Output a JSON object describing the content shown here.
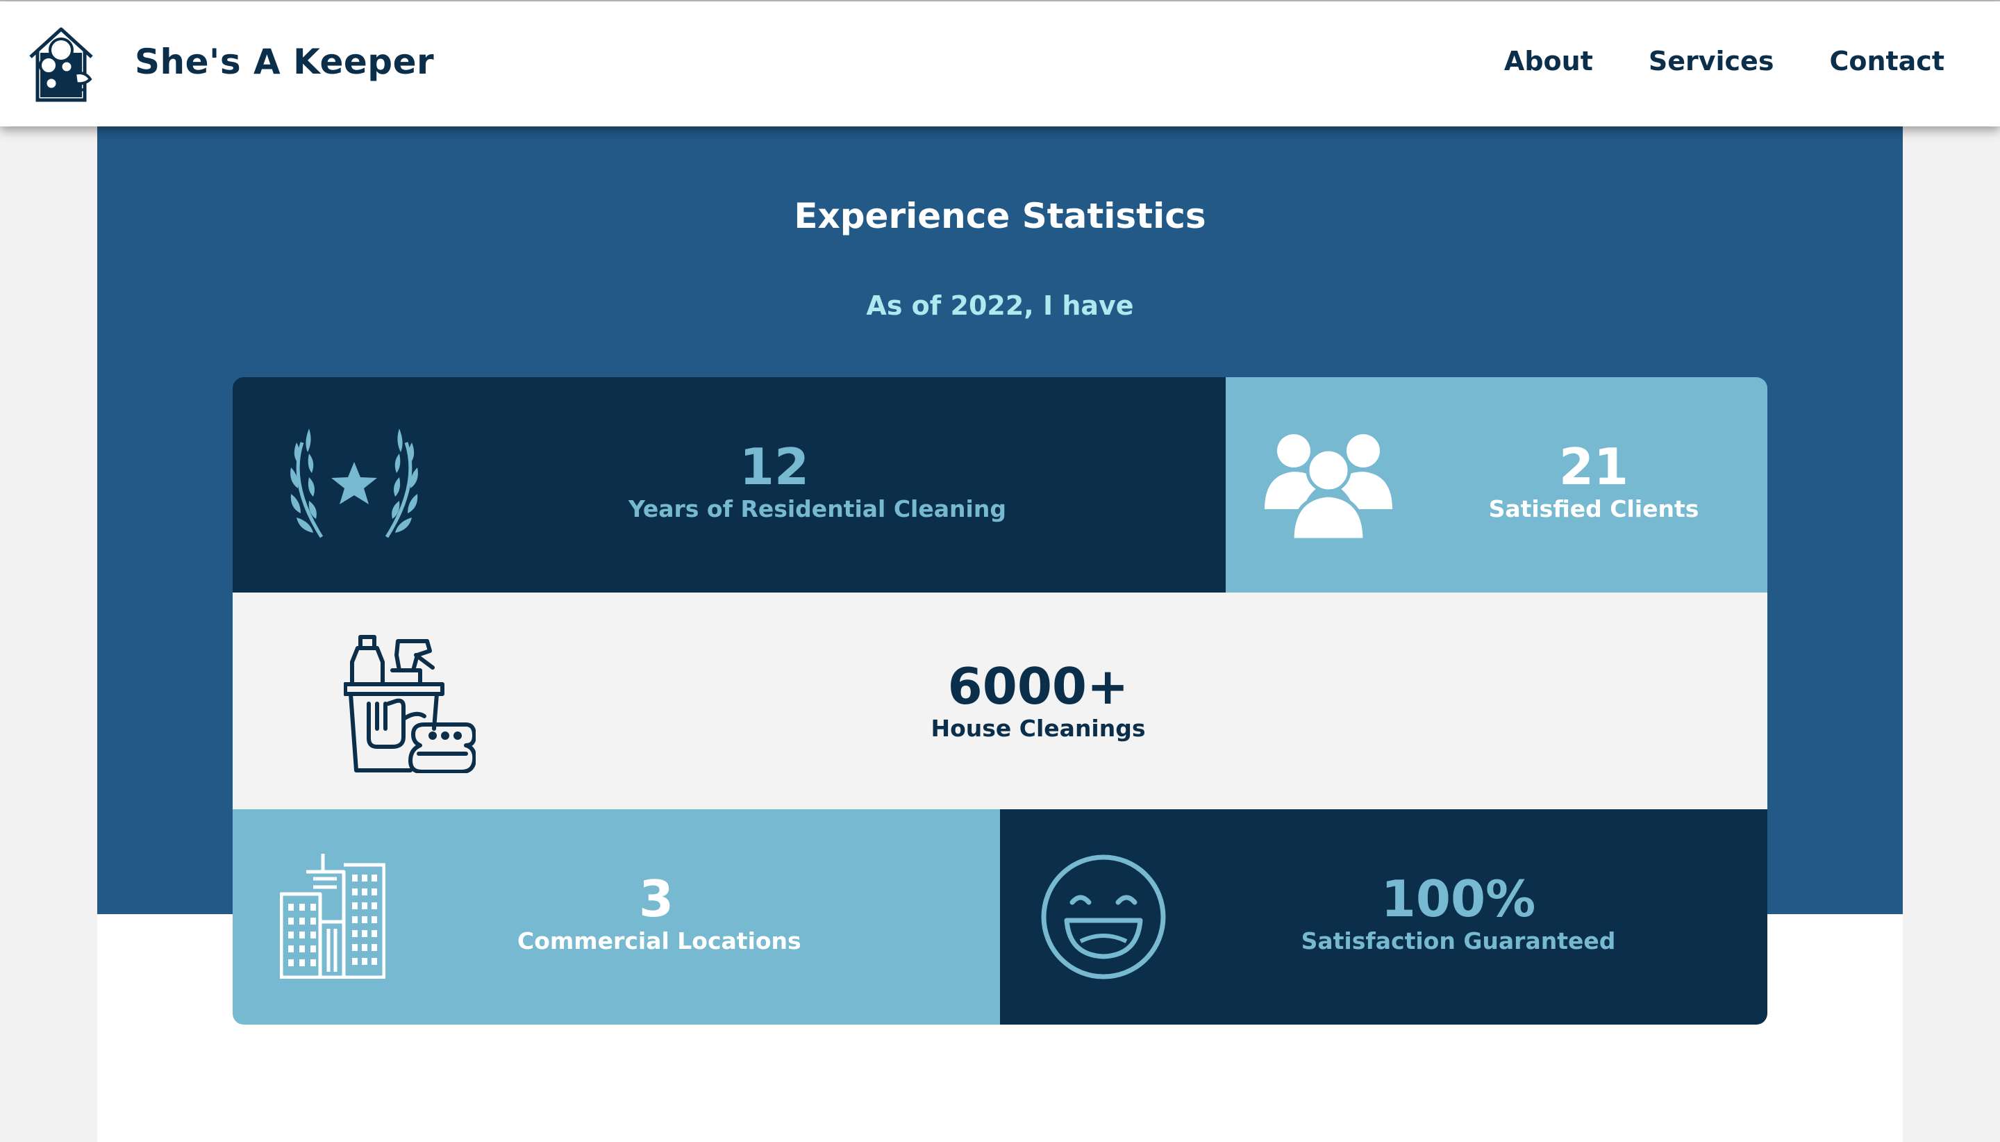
{
  "header": {
    "brand": "She's A Keeper",
    "nav": [
      "About",
      "Services",
      "Contact"
    ]
  },
  "section": {
    "title": "Experience Statistics",
    "subtitle": "As of 2022, I have"
  },
  "stats": [
    {
      "value": "12",
      "label": "Years of Residential Cleaning",
      "icon": "laurel-star-icon"
    },
    {
      "value": "21",
      "label": "Satisfied Clients",
      "icon": "group-users-icon"
    },
    {
      "value": "6000+",
      "label": "House Cleanings",
      "icon": "cleaning-supplies-icon"
    },
    {
      "value": "3",
      "label": "Commercial Locations",
      "icon": "buildings-icon"
    },
    {
      "value": "100%",
      "label": "Satisfaction Guaranteed",
      "icon": "smiley-face-icon"
    }
  ],
  "colors": {
    "navy": "#0b2f4b",
    "hero_blue": "#225986",
    "light_blue": "#76b9d1",
    "subtitle_teal": "#aee9ef",
    "pale_gray": "#f3f3f3"
  }
}
